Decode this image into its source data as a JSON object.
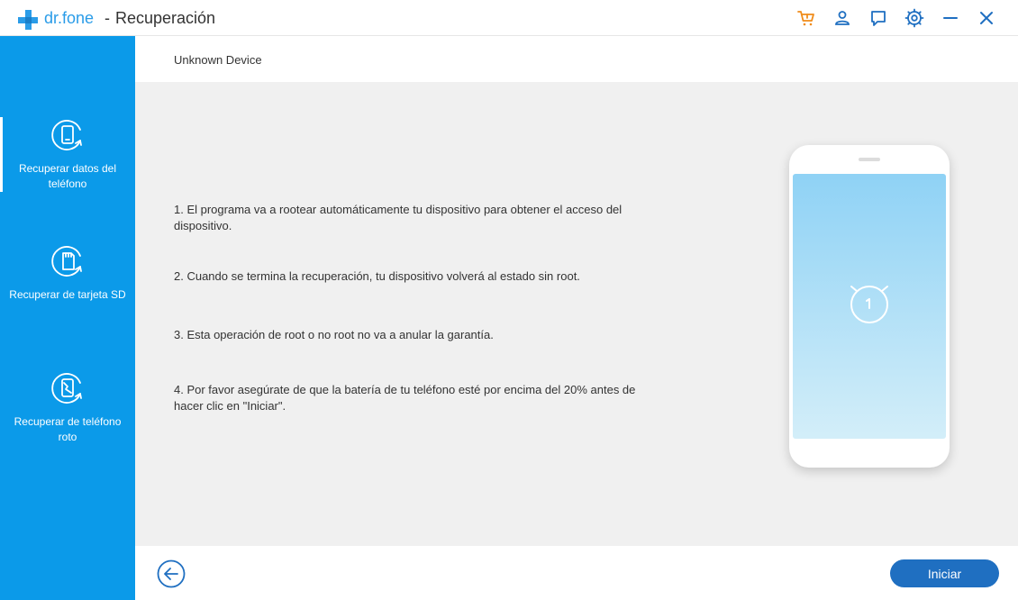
{
  "titlebar": {
    "brand": "dr.fone",
    "separator": "-",
    "title": "Recuperación",
    "icons": [
      "cart-icon",
      "user-icon",
      "feedback-icon",
      "settings-icon",
      "minimize-icon",
      "close-icon"
    ]
  },
  "colors": {
    "brand_blue": "#2a9ce8",
    "sidebar_blue": "#0b9ae9",
    "cart_orange": "#f08c1a",
    "start_button": "#1f6fc1",
    "content_bg": "#f0f0f0"
  },
  "sidebar": {
    "items": [
      {
        "label": "Recuperar datos del teléfono",
        "icon": "phone-recovery-icon",
        "active": true
      },
      {
        "label": "Recuperar de tarjeta SD",
        "icon": "sd-card-recovery-icon",
        "active": false
      },
      {
        "label": "Recuperar de teléfono roto",
        "icon": "broken-phone-recovery-icon",
        "active": false
      }
    ]
  },
  "device": {
    "name": "Unknown Device"
  },
  "instructions": [
    "1. El programa va a rootear automáticamente tu dispositivo para obtener el acceso del dispositivo.",
    "2. Cuando se termina la recuperación, tu dispositivo volverá al estado sin root.",
    "3. Esta operación de root o no root no va a anular la garantía.",
    "4. Por favor asegúrate de que la batería de tu teléfono esté por encima del 20% antes de hacer clic en \"Iniciar\"."
  ],
  "footer": {
    "start_label": "Iniciar"
  }
}
